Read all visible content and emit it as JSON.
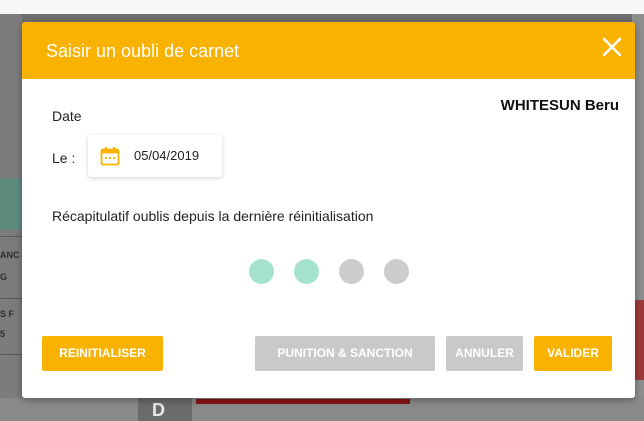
{
  "modal": {
    "title": "Saisir un oubli de carnet",
    "student_name": "WHITESUN Beru",
    "date_label": "Date",
    "le_label": "Le :",
    "date_value": "05/04/2019",
    "recap_text": "Récapitulatif oublis depuis la dernière réinitialisation",
    "forgotten_count": 2,
    "max_count": 4,
    "buttons": {
      "reinitialiser": "REINITIALISER",
      "punition": "PUNITION & SANCTION",
      "annuler": "ANNULER",
      "valider": "VALIDER"
    }
  },
  "background": {
    "left_snippets": [
      "ANC",
      "G",
      "S F",
      "5"
    ],
    "bottom_letter": "D"
  },
  "colors": {
    "accent": "#f9b200",
    "dot_filled": "#a5e3cf",
    "dot_empty": "#cccccc",
    "button_disabled": "#c9c9c9"
  },
  "icons": {
    "close": "close-icon",
    "calendar": "calendar-icon"
  }
}
